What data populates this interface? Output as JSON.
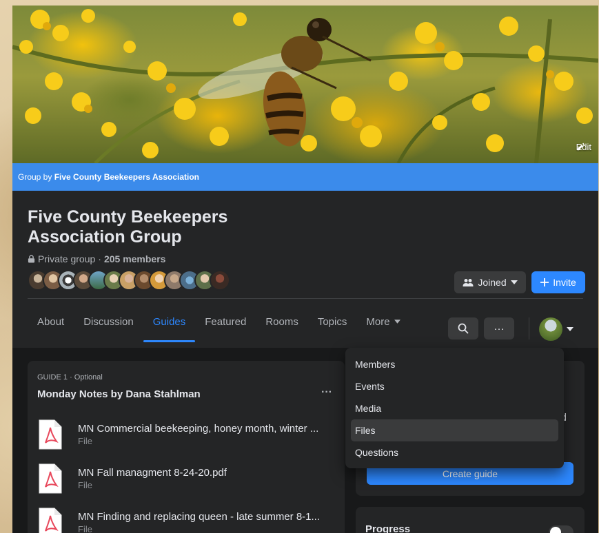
{
  "cover": {
    "edit_label": "Edit"
  },
  "banner": {
    "prefix": "Group by ",
    "org": "Five County Beekeepers Association"
  },
  "group": {
    "title": "Five County Beekeepers Association Group",
    "privacy": "Private group",
    "separator": " · ",
    "members": "205 members"
  },
  "actions": {
    "joined_label": "Joined",
    "invite_label": "Invite"
  },
  "tabs": [
    {
      "label": "About"
    },
    {
      "label": "Discussion"
    },
    {
      "label": "Guides",
      "active": true
    },
    {
      "label": "Featured"
    },
    {
      "label": "Rooms"
    },
    {
      "label": "Topics"
    },
    {
      "label": "More"
    }
  ],
  "toolbar": {
    "more_options": "···"
  },
  "guide": {
    "kicker": "GUIDE 1 · Optional",
    "title": "Monday Notes by Dana Stahlman",
    "menu": "···",
    "files": [
      {
        "name": "MN Commercial beekeeping, honey month, winter ...",
        "type": "File"
      },
      {
        "name": "MN Fall managment 8-24-20.pdf",
        "type": "File"
      },
      {
        "name": "MN Finding and replacing queen - late summer 8-1...",
        "type": "File"
      }
    ]
  },
  "side": {
    "fragment": "d",
    "create_guide": "Create guide",
    "progress_label": "Progress"
  },
  "more_menu": {
    "items": [
      {
        "label": "Members"
      },
      {
        "label": "Events"
      },
      {
        "label": "Media"
      },
      {
        "label": "Files",
        "hovered": true
      },
      {
        "label": "Questions"
      }
    ]
  },
  "colors": {
    "accent": "#2d88ff",
    "banner": "#3b8beb",
    "surface": "#242526",
    "background": "#18191a"
  },
  "icons": [
    "pencil-icon",
    "lock-icon",
    "people-icon",
    "caret-down-icon",
    "plus-icon",
    "search-icon",
    "pdf-file-icon"
  ]
}
